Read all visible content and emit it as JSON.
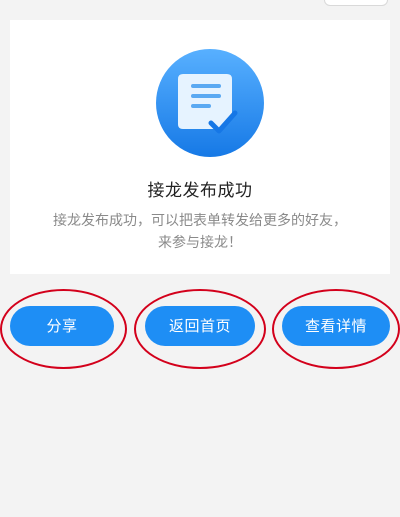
{
  "result": {
    "title": "接龙发布成功",
    "description_line1": "接龙发布成功，可以把表单转发给更多的好友，",
    "description_line2": "来参与接龙！"
  },
  "actions": {
    "share_label": "分享",
    "home_label": "返回首页",
    "detail_label": "查看详情"
  },
  "colors": {
    "primary": "#1e8ef5",
    "badge_light": "#5ab2ff",
    "annotation": "#d3001b",
    "background": "#f3f3f3"
  },
  "icons": {
    "badge": "document-check-icon"
  }
}
